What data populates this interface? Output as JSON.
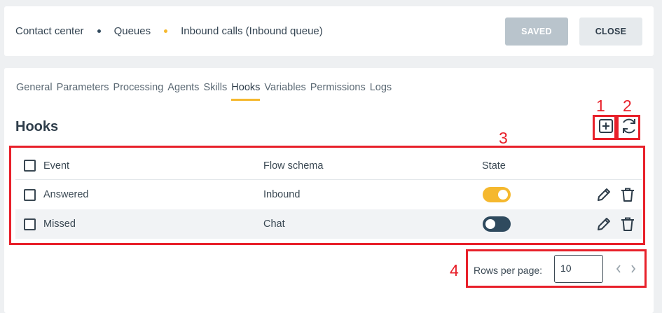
{
  "breadcrumb": {
    "items": [
      "Contact center",
      "Queues",
      "Inbound calls (Inbound queue)"
    ]
  },
  "header": {
    "saved_label": "SAVED",
    "close_label": "CLOSE"
  },
  "tabs": [
    {
      "label": "General",
      "active": false
    },
    {
      "label": "Parameters",
      "active": false
    },
    {
      "label": "Processing",
      "active": false
    },
    {
      "label": "Agents",
      "active": false
    },
    {
      "label": "Skills",
      "active": false
    },
    {
      "label": "Hooks",
      "active": true
    },
    {
      "label": "Variables",
      "active": false
    },
    {
      "label": "Permissions",
      "active": false
    },
    {
      "label": "Logs",
      "active": false
    }
  ],
  "section_title": "Hooks",
  "table": {
    "columns": [
      "Event",
      "Flow schema",
      "State"
    ],
    "rows": [
      {
        "event": "Answered",
        "flow": "Inbound",
        "state": true
      },
      {
        "event": "Missed",
        "flow": "Chat",
        "state": false
      }
    ]
  },
  "pagination": {
    "label": "Rows per page:",
    "value": "10"
  },
  "callouts": [
    "1",
    "2",
    "3",
    "4"
  ],
  "colors": {
    "accent": "#f5b82e",
    "dark": "#2f4a5e",
    "annotation": "#e8202a",
    "saved_disabled": "#b9c4cc"
  },
  "icons": [
    "add-icon",
    "refresh-icon",
    "edit-icon",
    "delete-icon",
    "chevron-left-icon",
    "chevron-right-icon",
    "checkbox-icon"
  ]
}
